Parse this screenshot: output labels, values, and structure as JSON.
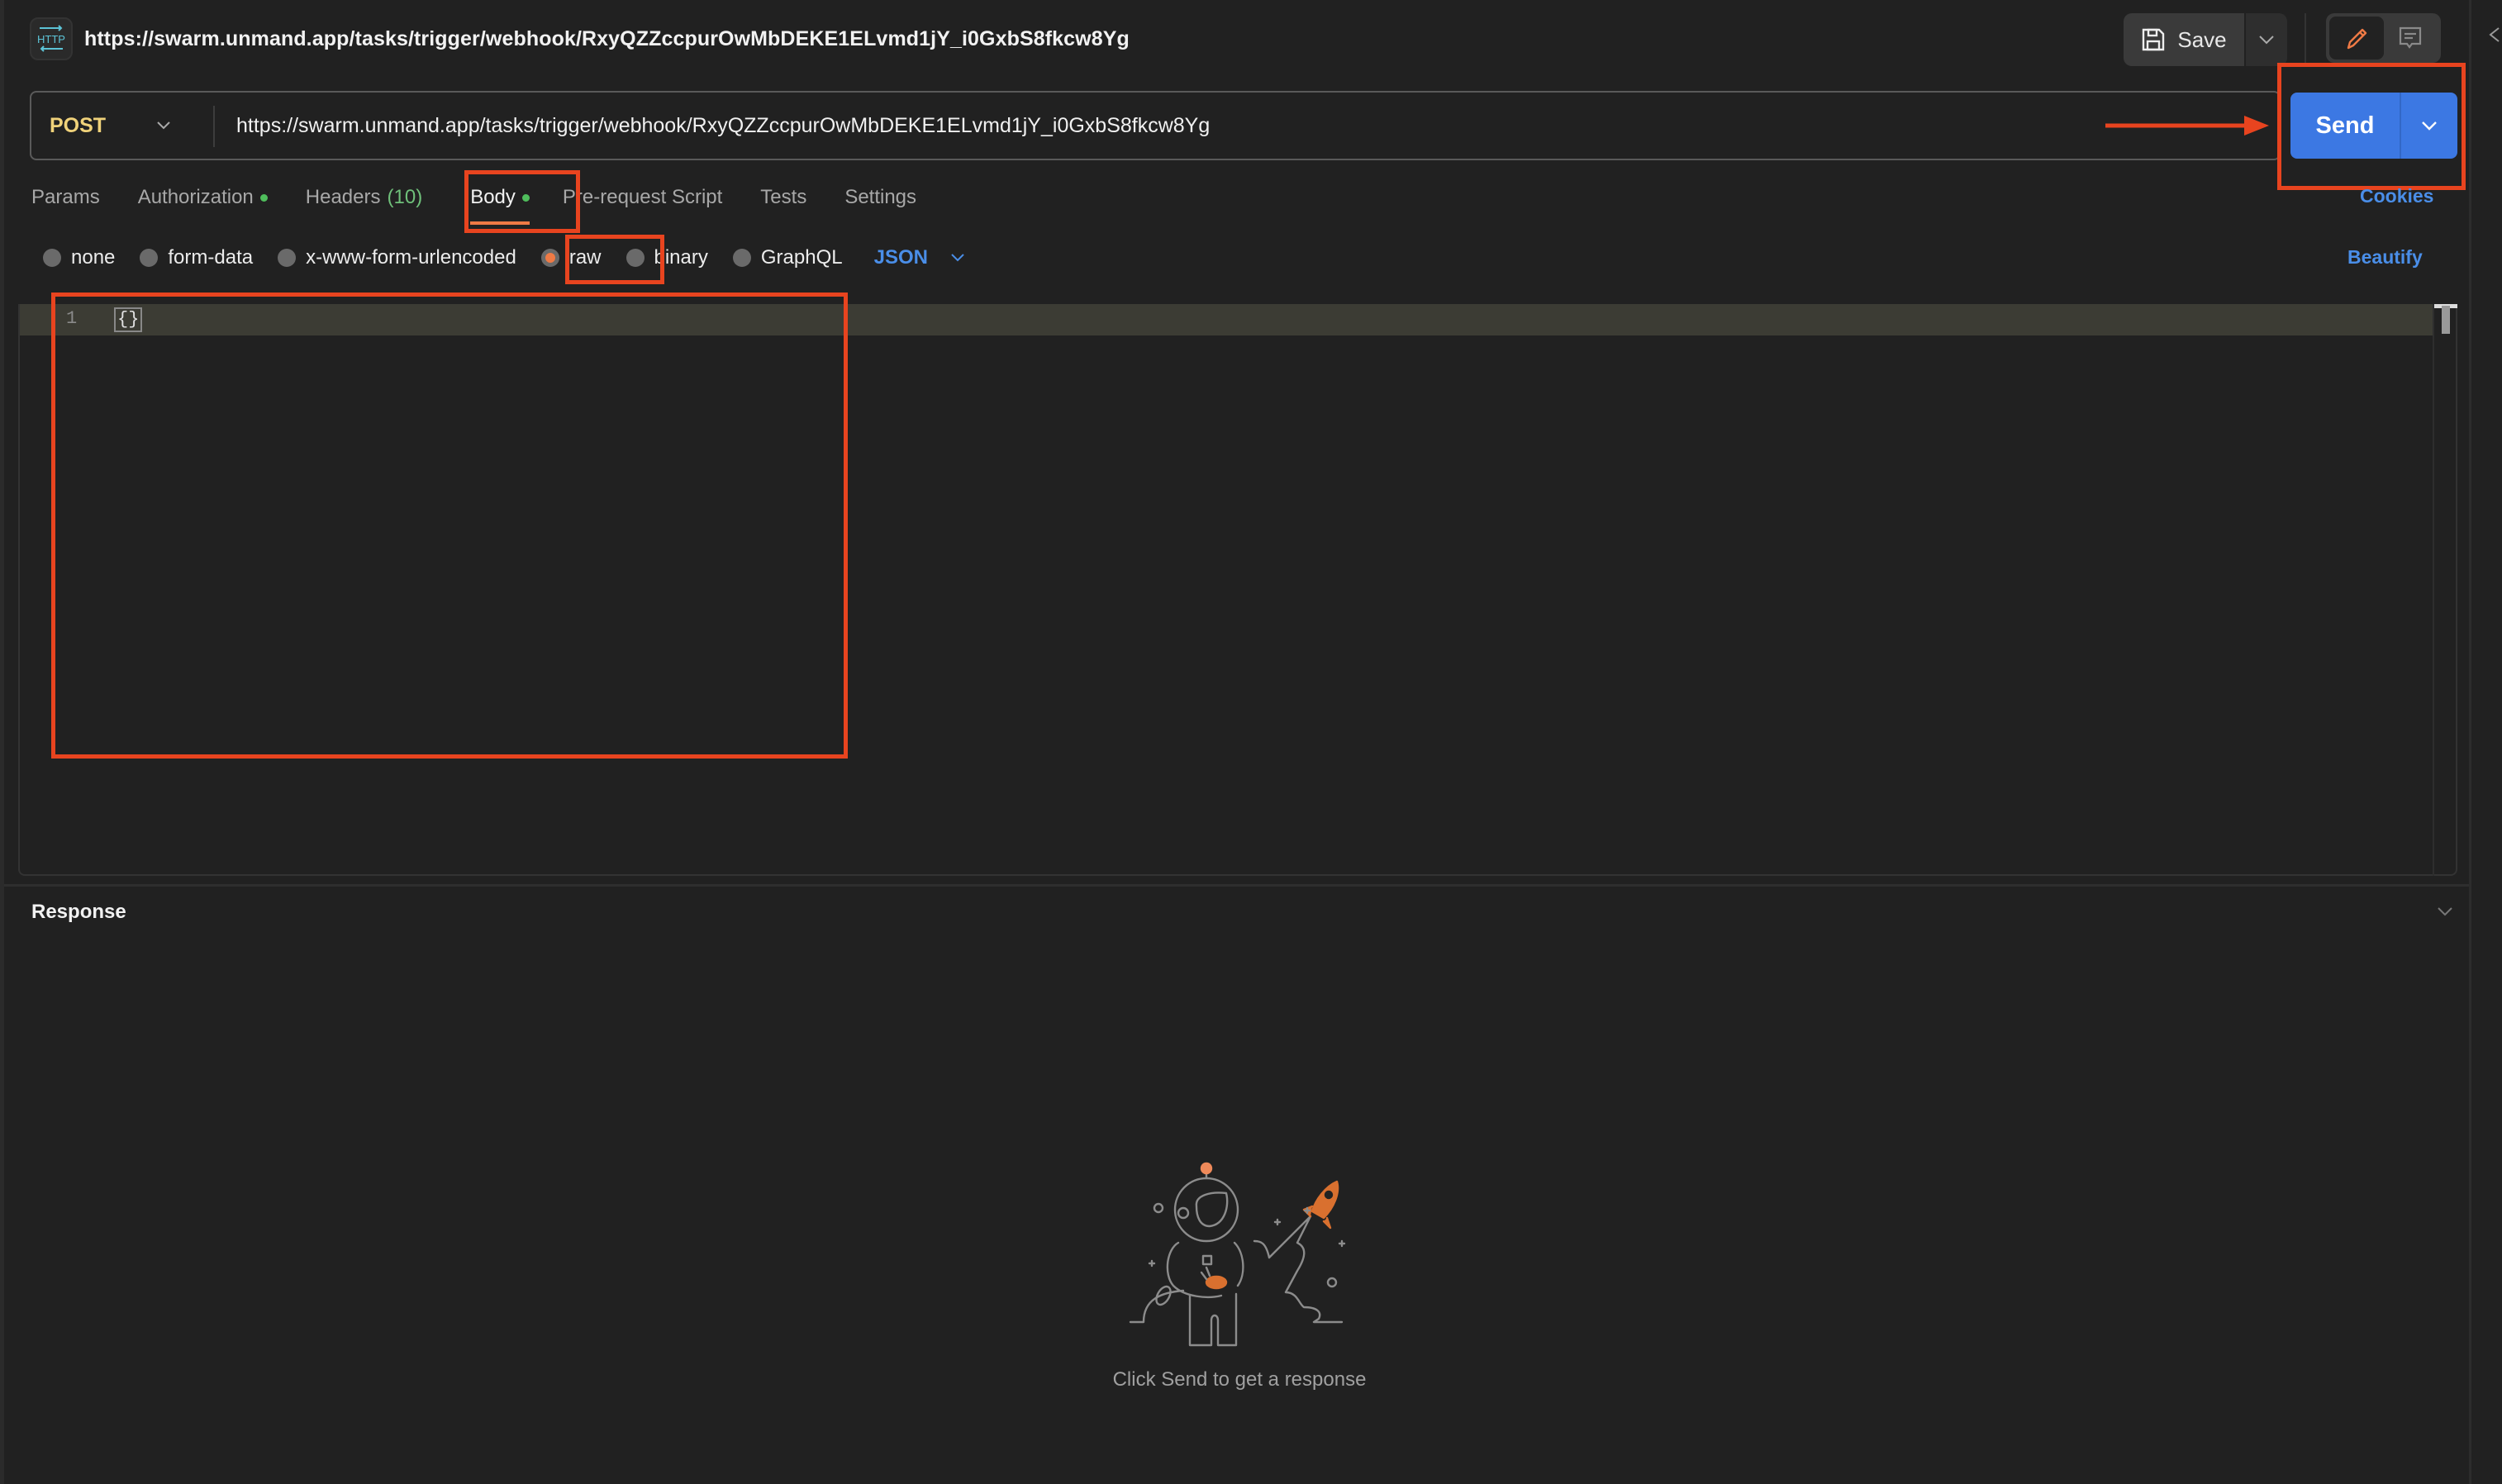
{
  "header": {
    "request_type_icon": "http-icon",
    "request_title": "https://swarm.unmand.app/tasks/trigger/webhook/RxyQZZccpurOwMbDEKE1ELvmd1jY_i0GxbS8fkcw8Yg",
    "save_label": "Save",
    "save_icon": "floppy-disk-icon",
    "mode_toggle": [
      {
        "name": "edit",
        "icon": "pencil-icon",
        "active": true
      },
      {
        "name": "comments",
        "icon": "comment-icon",
        "active": false
      }
    ]
  },
  "request": {
    "method": "POST",
    "url": "https://swarm.unmand.app/tasks/trigger/webhook/RxyQZZccpurOwMbDEKE1ELvmd1jY_i0GxbS8fkcw8Yg",
    "send_label": "Send",
    "cookies_label": "Cookies"
  },
  "tabs": [
    {
      "label": "Params",
      "active": false
    },
    {
      "label": "Authorization",
      "indicator": "green-dot",
      "active": false
    },
    {
      "label": "Headers",
      "count": "(10)",
      "active": false
    },
    {
      "label": "Body",
      "indicator": "green-dot",
      "active": true
    },
    {
      "label": "Pre-request Script",
      "active": false
    },
    {
      "label": "Tests",
      "active": false
    },
    {
      "label": "Settings",
      "active": false
    }
  ],
  "body": {
    "types": [
      {
        "label": "none",
        "checked": false
      },
      {
        "label": "form-data",
        "checked": false
      },
      {
        "label": "x-www-form-urlencoded",
        "checked": false
      },
      {
        "label": "raw",
        "checked": true
      },
      {
        "label": "binary",
        "checked": false
      },
      {
        "label": "GraphQL",
        "checked": false
      }
    ],
    "language": "JSON",
    "beautify_label": "Beautify",
    "editor": {
      "lines": [
        {
          "number": "1",
          "code": "{}"
        }
      ]
    }
  },
  "response": {
    "title": "Response",
    "empty_message": "Click Send to get a response",
    "illustration": "astronaut-rocket-illustration"
  },
  "colors": {
    "accent_blue": "#3c78e3",
    "link_blue": "#4a8ee8",
    "active_orange": "#ef7a45",
    "method_yellow": "#f0d27a",
    "status_green": "#4fbe5c",
    "annotation_red": "#e8441f",
    "background": "#212121"
  }
}
